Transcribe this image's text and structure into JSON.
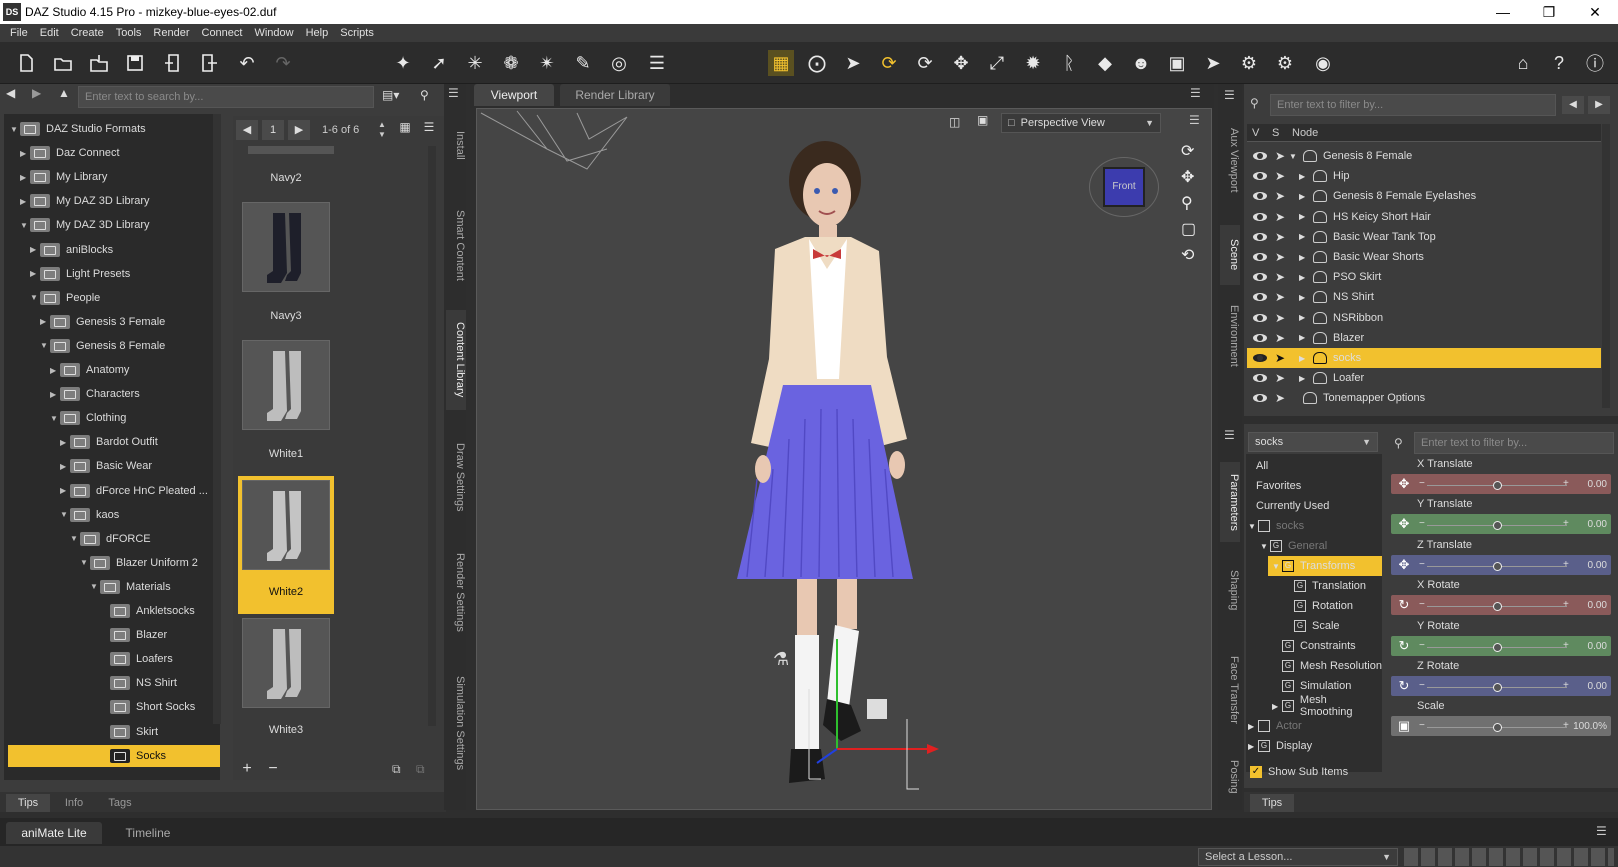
{
  "app": {
    "title": "DAZ Studio 4.15 Pro - mizkey-blue-eyes-02.duf",
    "logo": "DS",
    "accent": "#f2c12e"
  },
  "menu": [
    "File",
    "Edit",
    "Create",
    "Tools",
    "Render",
    "Connect",
    "Window",
    "Help",
    "Scripts"
  ],
  "content_library": {
    "search_placeholder": "Enter text to search by...",
    "tree": [
      {
        "label": "DAZ Studio Formats",
        "depth": 0,
        "expanded": true
      },
      {
        "label": "Daz Connect",
        "depth": 1
      },
      {
        "label": "My Library",
        "depth": 1
      },
      {
        "label": "My DAZ 3D Library",
        "depth": 1
      },
      {
        "label": "My DAZ 3D Library",
        "depth": 1,
        "expanded": true
      },
      {
        "label": "aniBlocks",
        "depth": 2
      },
      {
        "label": "Light Presets",
        "depth": 2
      },
      {
        "label": "People",
        "depth": 2,
        "expanded": true
      },
      {
        "label": "Genesis 3 Female",
        "depth": 3
      },
      {
        "label": "Genesis 8 Female",
        "depth": 3,
        "expanded": true
      },
      {
        "label": "Anatomy",
        "depth": 4
      },
      {
        "label": "Characters",
        "depth": 4
      },
      {
        "label": "Clothing",
        "depth": 4,
        "expanded": true
      },
      {
        "label": "Bardot Outfit",
        "depth": 5
      },
      {
        "label": "Basic Wear",
        "depth": 5
      },
      {
        "label": "dForce HnC Pleated ...",
        "depth": 5
      },
      {
        "label": "kaos",
        "depth": 5,
        "expanded": true
      },
      {
        "label": "dFORCE",
        "depth": 6,
        "expanded": true
      },
      {
        "label": "Blazer Uniform 2",
        "depth": 7,
        "expanded": true
      },
      {
        "label": "Materials",
        "depth": 8,
        "expanded": true
      },
      {
        "label": "Ankletsocks",
        "depth": 9
      },
      {
        "label": "Blazer",
        "depth": 9
      },
      {
        "label": "Loafers",
        "depth": 9
      },
      {
        "label": "NS Shirt",
        "depth": 9
      },
      {
        "label": "Short Socks",
        "depth": 9
      },
      {
        "label": "Skirt",
        "depth": 9
      },
      {
        "label": "Socks",
        "depth": 9,
        "selected": true
      }
    ],
    "page": "1",
    "page_range": "1-6 of 6",
    "thumbs": [
      "Navy2",
      "Navy3",
      "White1",
      "White2",
      "White3"
    ],
    "selected_thumb": "White2",
    "bottom_tabs": [
      "Tips",
      "Info",
      "Tags"
    ],
    "side_tabs": [
      "Install",
      "Smart Content",
      "Content Library",
      "Draw Settings",
      "Render Settings",
      "Simulation Settings"
    ]
  },
  "viewport": {
    "tabs": [
      "Viewport",
      "Render Library"
    ],
    "active_tab": "Viewport",
    "view_select": "Perspective View",
    "cube_label": "Front",
    "bg": "#454545"
  },
  "scene": {
    "side_tabs": [
      "Aux Viewport",
      "Scene",
      "Environment"
    ],
    "filter_placeholder": "Enter text to filter by...",
    "headers": {
      "v": "V",
      "s": "S",
      "node": "Node"
    },
    "nodes": [
      {
        "label": "Genesis 8 Female",
        "indent": 0
      },
      {
        "label": "Hip",
        "indent": 1,
        "bone": true
      },
      {
        "label": "Genesis 8 Female Eyelashes",
        "indent": 1
      },
      {
        "label": "HS Keicy Short Hair",
        "indent": 1
      },
      {
        "label": "Basic Wear Tank Top",
        "indent": 1
      },
      {
        "label": "Basic Wear Shorts",
        "indent": 1
      },
      {
        "label": "PSO Skirt",
        "indent": 1
      },
      {
        "label": "NS Shirt",
        "indent": 1
      },
      {
        "label": "NSRibbon",
        "indent": 1
      },
      {
        "label": "Blazer",
        "indent": 1
      },
      {
        "label": "socks",
        "indent": 1,
        "selected": true
      },
      {
        "label": "Loafer",
        "indent": 1
      },
      {
        "label": "Tonemapper Options",
        "indent": 0
      }
    ]
  },
  "parameters": {
    "side_tabs": [
      "Parameters",
      "Shaping",
      "Face Transfer",
      "Posing"
    ],
    "node_select": "socks",
    "filter_placeholder": "Enter text to filter by...",
    "categories": [
      "All",
      "Favorites",
      "Currently Used"
    ],
    "groups": [
      {
        "label": "socks",
        "dim": true
      },
      {
        "label": "General",
        "dim": true
      },
      {
        "label": "Transforms",
        "selected": true
      },
      {
        "label": "Translation"
      },
      {
        "label": "Rotation"
      },
      {
        "label": "Scale"
      },
      {
        "label": "Constraints"
      },
      {
        "label": "Mesh Resolution"
      },
      {
        "label": "Simulation"
      },
      {
        "label": "Mesh Smoothing"
      },
      {
        "label": "Actor",
        "dim": true
      },
      {
        "label": "Display"
      }
    ],
    "show_sub_items": "Show Sub Items",
    "sliders": [
      {
        "label": "X Translate",
        "value": "0.00",
        "color": "#8a5a5a",
        "icon": "move"
      },
      {
        "label": "Y Translate",
        "value": "0.00",
        "color": "#5f8a5f",
        "icon": "move"
      },
      {
        "label": "Z Translate",
        "value": "0.00",
        "color": "#5a5f8a",
        "icon": "move"
      },
      {
        "label": "X Rotate",
        "value": "0.00",
        "color": "#8a5a5a",
        "icon": "rotate"
      },
      {
        "label": "Y Rotate",
        "value": "0.00",
        "color": "#5f8a5f",
        "icon": "rotate"
      },
      {
        "label": "Z Rotate",
        "value": "0.00",
        "color": "#5a5f8a",
        "icon": "rotate"
      },
      {
        "label": "Scale",
        "value": "100.0%",
        "color": "#707070",
        "icon": "scale"
      }
    ],
    "bottom_tab": "Tips"
  },
  "timeline": {
    "tabs": [
      "aniMate Lite",
      "Timeline"
    ],
    "active_tab": "aniMate Lite",
    "lesson": "Select a Lesson..."
  }
}
